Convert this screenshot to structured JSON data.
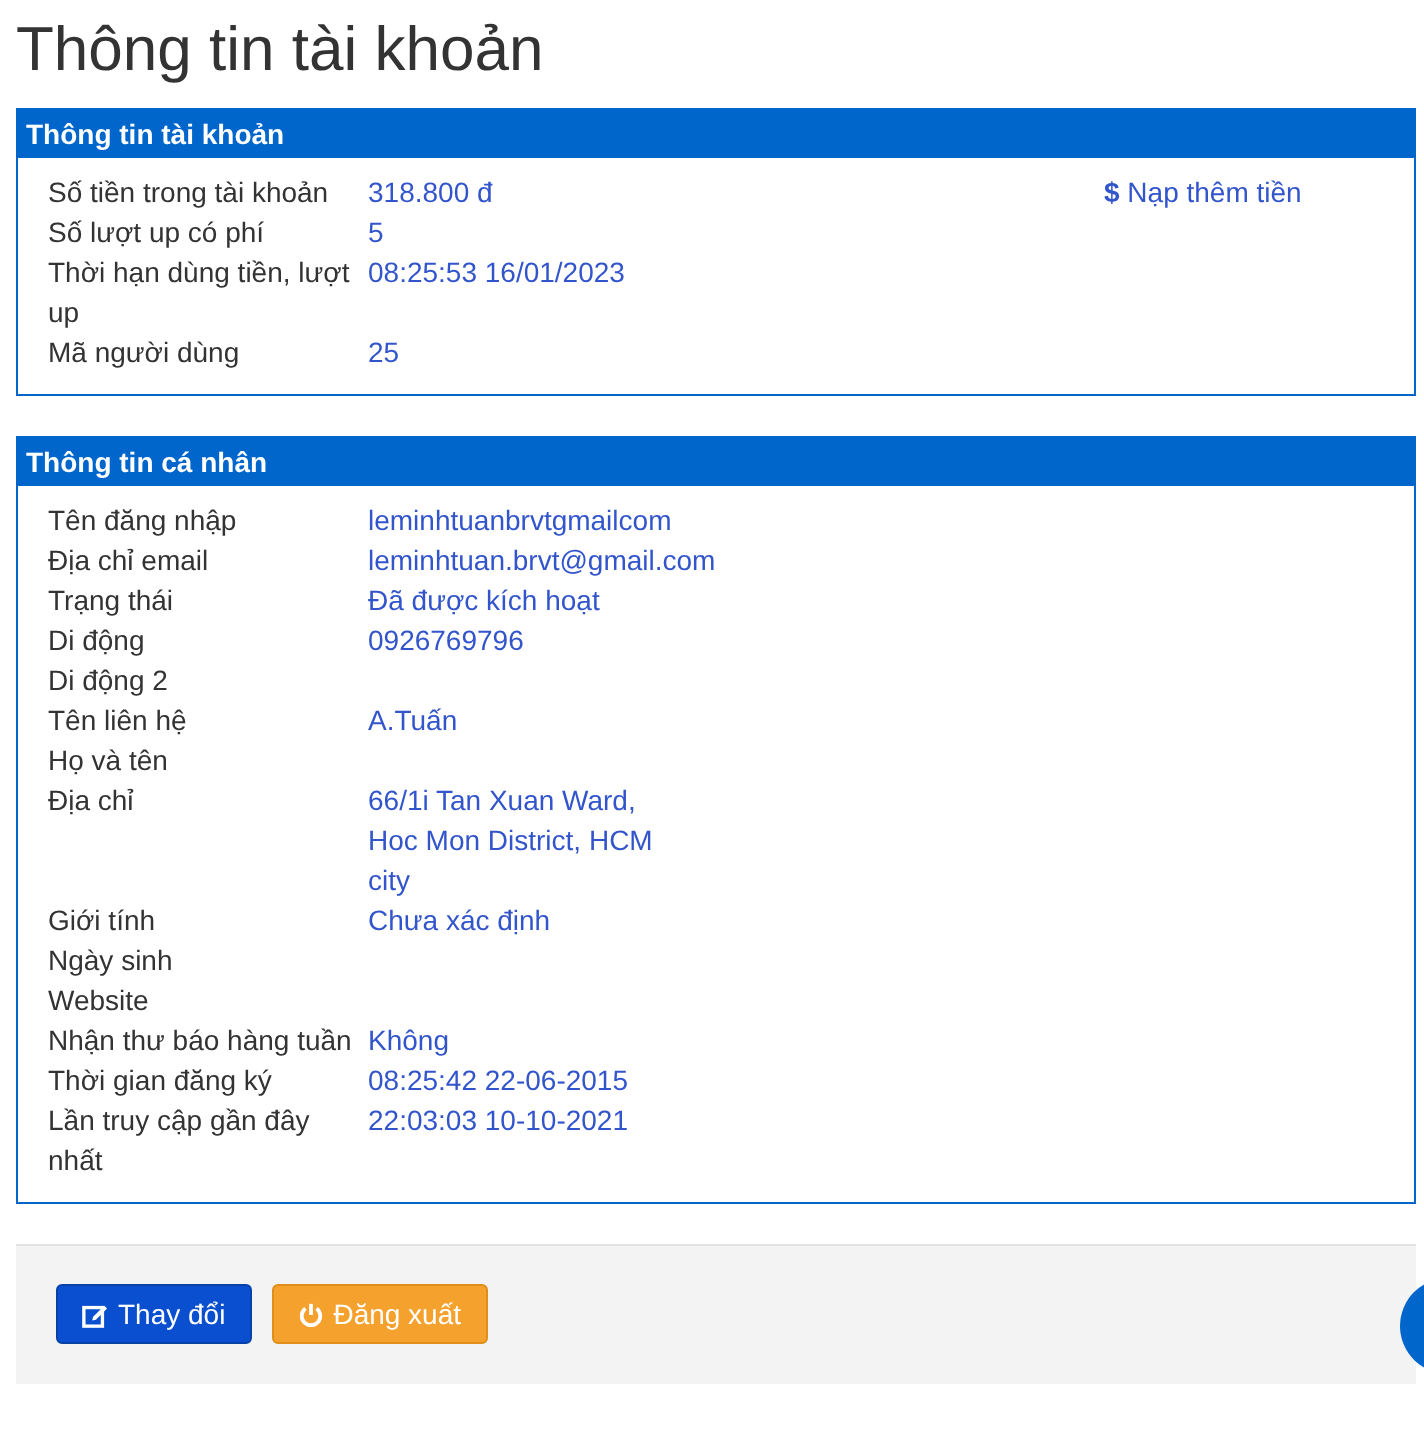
{
  "page_title": "Thông tin tài khoản",
  "account_panel": {
    "title": "Thông tin tài khoản",
    "rows": [
      {
        "label": "Số tiền trong tài khoản",
        "value": "318.800 đ"
      },
      {
        "label": "Số lượt up có phí",
        "value": "5"
      },
      {
        "label": "Thời hạn dùng tiền, lượt up",
        "value": "08:25:53 16/01/2023"
      },
      {
        "label": "Mã người dùng",
        "value": "25"
      }
    ],
    "topup_link": {
      "icon": "$",
      "label": "Nạp thêm tiền"
    }
  },
  "personal_panel": {
    "title": "Thông tin cá nhân",
    "rows": [
      {
        "label": "Tên đăng nhập",
        "value": "leminhtuanbrvtgmailcom"
      },
      {
        "label": "Địa chỉ email",
        "value": "leminhtuan.brvt@gmail.com"
      },
      {
        "label": "Trạng thái",
        "value": "Đã được kích hoạt"
      },
      {
        "label": "Di động",
        "value": "0926769796"
      },
      {
        "label": "Di động 2"
      },
      {
        "label": "Tên liên hệ",
        "value": "A.Tuấn"
      },
      {
        "label": "Họ và tên"
      },
      {
        "label": "Địa chỉ",
        "value": "66/1i Tan Xuan Ward, Hoc Mon District, HCM city"
      },
      {
        "label": "Giới tính",
        "value": "Chưa xác định"
      },
      {
        "label": "Ngày sinh"
      },
      {
        "label": "Website"
      },
      {
        "label": "Nhận thư báo hàng tuần",
        "value": "Không"
      },
      {
        "label": "Thời gian đăng ký",
        "value": "08:25:42 22-06-2015"
      },
      {
        "label": "Lần truy cập gần đây nhất",
        "value": "22:03:03 10-10-2021"
      }
    ]
  },
  "buttons": [
    {
      "kind": "edit",
      "label": "Thay đổi"
    },
    {
      "kind": "logout",
      "label": "Đăng xuất"
    }
  ]
}
